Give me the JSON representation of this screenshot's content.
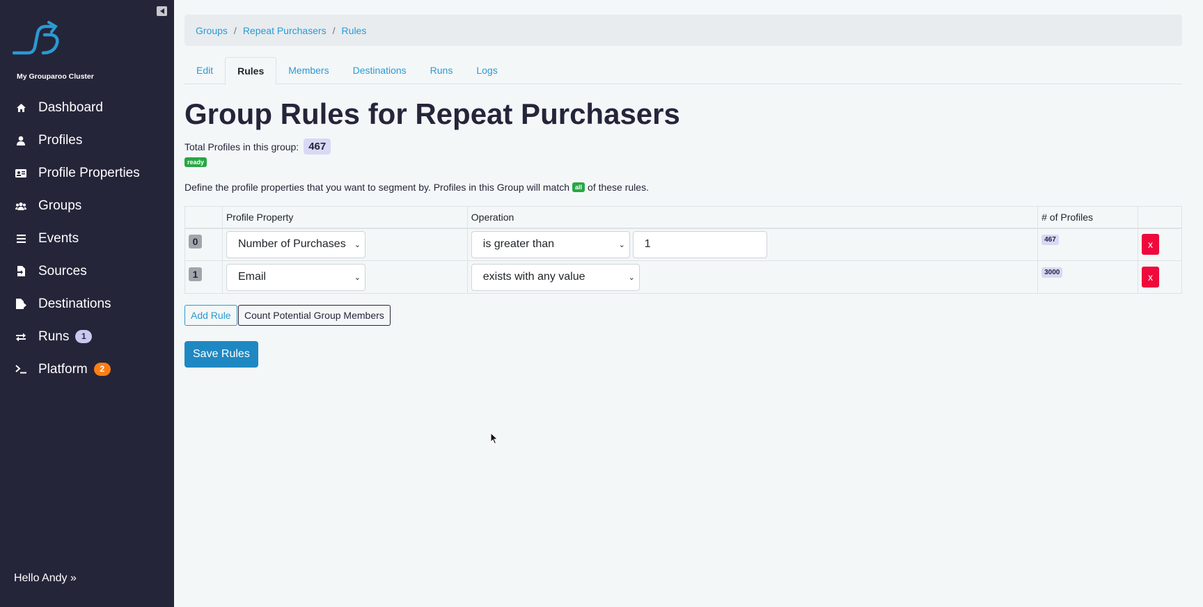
{
  "sidebar": {
    "cluster_name": "My Grouparoo Cluster",
    "items": [
      {
        "label": "Dashboard",
        "icon": "home-icon"
      },
      {
        "label": "Profiles",
        "icon": "user-icon"
      },
      {
        "label": "Profile Properties",
        "icon": "id-card-icon"
      },
      {
        "label": "Groups",
        "icon": "users-icon"
      },
      {
        "label": "Events",
        "icon": "list-icon"
      },
      {
        "label": "Sources",
        "icon": "file-import-icon"
      },
      {
        "label": "Destinations",
        "icon": "file-export-icon"
      },
      {
        "label": "Runs",
        "icon": "exchange-icon",
        "badge": "1"
      },
      {
        "label": "Platform",
        "icon": "terminal-icon",
        "badge": "2"
      }
    ],
    "user_greeting": "Hello Andy »",
    "colors": {
      "background": "#25253a",
      "runs_badge": "#c9c8ef",
      "platform_badge": "#fd7e14"
    }
  },
  "breadcrumb": [
    "Groups",
    "Repeat Purchasers",
    "Rules"
  ],
  "tabs": [
    {
      "label": "Edit",
      "active": false
    },
    {
      "label": "Rules",
      "active": true
    },
    {
      "label": "Members",
      "active": false
    },
    {
      "label": "Destinations",
      "active": false
    },
    {
      "label": "Runs",
      "active": false
    },
    {
      "label": "Logs",
      "active": false
    }
  ],
  "page": {
    "title": "Group Rules for Repeat Purchasers",
    "total_label": "Total Profiles in this group:",
    "total_count": "467",
    "state": "ready",
    "define_prefix": "Define the profile properties that you want to segment by. Profiles in this Group will match",
    "match_badge": "all",
    "define_suffix": "of these rules."
  },
  "table": {
    "headers": [
      "",
      "Profile Property",
      "Operation",
      "# of Profiles",
      ""
    ],
    "rows": [
      {
        "index": "0",
        "property": "Number of Purchases",
        "operation": "is greater than",
        "value": "1",
        "profiles": "467",
        "remove": "x"
      },
      {
        "index": "1",
        "property": "Email",
        "operation": "exists with any value",
        "value": null,
        "profiles": "3000",
        "remove": "x"
      }
    ]
  },
  "buttons": {
    "add_rule": "Add Rule",
    "count": "Count Potential Group Members",
    "save": "Save Rules"
  },
  "colors": {
    "link": "#2a9ad3",
    "danger": "#ee0a3c",
    "success": "#28a745",
    "primary": "#1f88c2"
  }
}
